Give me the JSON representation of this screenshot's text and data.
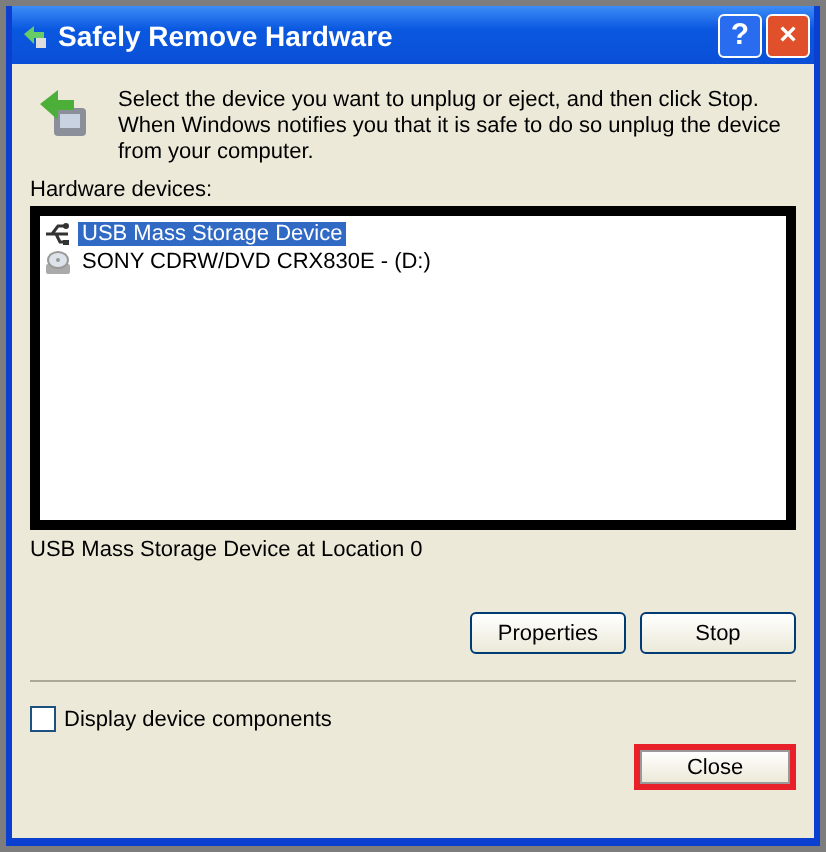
{
  "window": {
    "title": "Safely Remove Hardware",
    "title_buttons": [
      "?",
      "×"
    ]
  },
  "instructions": "Select the device you want to unplug or eject, and then click Stop. When Windows notifies you that it is safe to do so unplug the device from your computer.",
  "devices_label": "Hardware devices:",
  "devices": [
    {
      "name": "USB Mass Storage Device",
      "kind": "usb",
      "selected": true
    },
    {
      "name": "SONY CDRW/DVD CRX830E - (D:)",
      "kind": "cdrom",
      "selected": false
    }
  ],
  "device_location": "USB Mass Storage Device at Location 0",
  "buttons": [
    "Properties",
    "Stop"
  ],
  "display_components": {
    "label": "Display device components",
    "checked": false
  },
  "close_button": {
    "label": "Close",
    "highlighted": true
  }
}
